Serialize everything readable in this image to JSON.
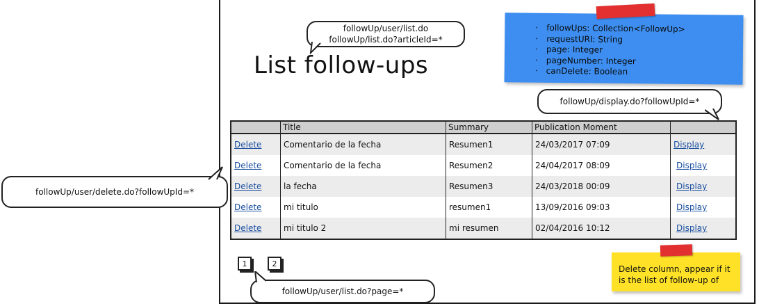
{
  "page": {
    "title": "List follow-ups"
  },
  "callouts": {
    "list_urls": [
      "followUp/user/list.do",
      "followUp/list.do?articleId=*"
    ],
    "display_url": "followUp/display.do?followUpId=*",
    "delete_url": "followUp/user/delete.do?followUpId=*",
    "pager_url": "followUp/user/list.do?page=*"
  },
  "model_note": {
    "items": [
      "followUps: Collection<FollowUp>",
      "requestURI: String",
      "page: Integer",
      "pageNumber: Integer",
      "canDelete: Boolean"
    ],
    "color": "#3d8ef0"
  },
  "delete_note": {
    "lines": [
      "Delete column, appear if it",
      "is the list of follow-up of"
    ],
    "color": "#ffe227"
  },
  "table": {
    "columns": [
      "",
      "Title",
      "Summary",
      "Publication Moment",
      ""
    ],
    "rows": [
      {
        "delete": "Delete",
        "title": "Comentario de la fecha",
        "summary": "Resumen1",
        "moment": "24/03/2017 07:09",
        "display": "Display"
      },
      {
        "delete": "Delete",
        "title": "Comentario de la fecha",
        "summary": "Resumen2",
        "moment": "24/04/2017 08:09",
        "display": "Display"
      },
      {
        "delete": "Delete",
        "title": "la fecha",
        "summary": "Resumen3",
        "moment": "24/03/2018 00:09",
        "display": "Display"
      },
      {
        "delete": "Delete",
        "title": "mi titulo",
        "summary": "resumen1",
        "moment": "13/09/2016 09:03",
        "display": "Display"
      },
      {
        "delete": "Delete",
        "title": "mi titulo 2",
        "summary": "mi resumen",
        "moment": "02/04/2016 10:12",
        "display": "Display"
      }
    ]
  },
  "pager": {
    "pages": [
      "1",
      "2"
    ]
  }
}
